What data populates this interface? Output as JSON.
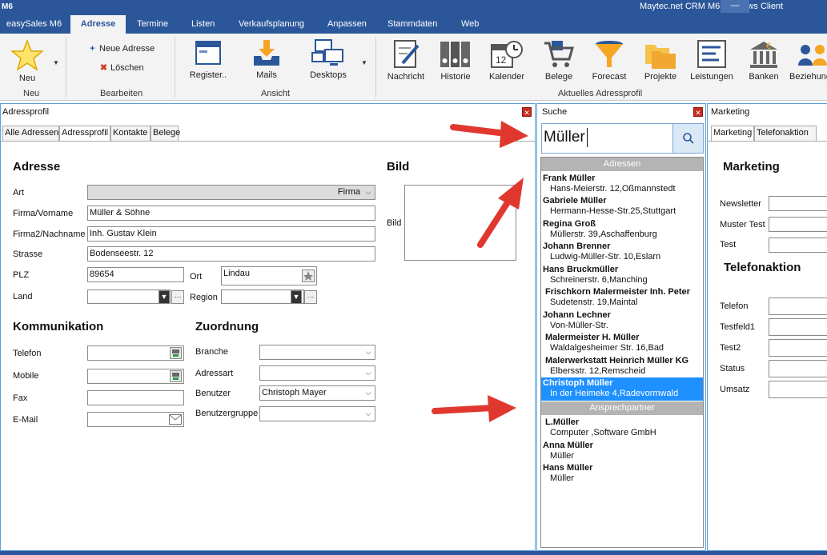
{
  "window": {
    "app_logo": "M6",
    "title": "Maytec.net CRM M6 Windows Client"
  },
  "menu_tabs": [
    {
      "label": "easySales M6"
    },
    {
      "label": "Adresse",
      "active": true
    },
    {
      "label": "Termine"
    },
    {
      "label": "Listen"
    },
    {
      "label": "Verkaufsplanung"
    },
    {
      "label": "Anpassen"
    },
    {
      "label": "Stammdaten"
    },
    {
      "label": "Web"
    }
  ],
  "ribbon": {
    "neu": {
      "button": "Neu",
      "group": "Neu"
    },
    "bearbeiten": {
      "neue_adresse": "Neue Adresse",
      "loeschen": "Löschen",
      "group": "Bearbeiten"
    },
    "ansicht": {
      "register": "Register..",
      "mails": "Mails",
      "desktops": "Desktops",
      "group": "Ansicht"
    },
    "profil": {
      "group": "Aktuelles Adressprofil",
      "buttons": [
        "Nachricht",
        "Historie",
        "Kalender",
        "Belege",
        "Forecast",
        "Projekte",
        "Leistungen",
        "Banken",
        "Beziehungen"
      ]
    }
  },
  "adressprofil": {
    "panel_title": "Adressprofil",
    "tabs": [
      "Alle Adressen",
      "Adressprofil",
      "Kontakte",
      "Belege"
    ],
    "adresse_title": "Adresse",
    "bild_title": "Bild",
    "bild_label": "Bild",
    "labels": {
      "art": "Art",
      "firma": "Firma/Vorname",
      "firma2": "Firma2/Nachname",
      "strasse": "Strasse",
      "plz": "PLZ",
      "ort": "Ort",
      "land": "Land",
      "region": "Region"
    },
    "values": {
      "art": "Firma",
      "firma": "Müller & Söhne",
      "firma2": "Inh. Gustav Klein",
      "strasse": "Bodenseestr. 12",
      "plz": "89654",
      "ort": "Lindau",
      "land": "",
      "region": ""
    },
    "kommunikation_title": "Kommunikation",
    "kommunikation_labels": {
      "telefon": "Telefon",
      "mobile": "Mobile",
      "fax": "Fax",
      "email": "E-Mail"
    },
    "zuordnung_title": "Zuordnung",
    "zuordnung_labels": {
      "branche": "Branche",
      "adressart": "Adressart",
      "benutzer": "Benutzer",
      "benutzergruppe": "Benutzergruppe"
    },
    "zuordnung_values": {
      "branche": "",
      "adressart": "",
      "benutzer": "Christoph Mayer",
      "benutzergruppe": ""
    },
    "more_button": "···"
  },
  "suche": {
    "panel_title": "Suche",
    "query": "Müller",
    "group_adressen": "Adressen",
    "adressen": [
      {
        "name": "Frank Müller",
        "detail": "Hans-Meierstr. 12,Oßmannstedt"
      },
      {
        "name": "Gabriele Müller",
        "detail": "Hermann-Hesse-Str.25,Stuttgart"
      },
      {
        "name": "Regina Groß",
        "detail": "Müllerstr. 39,Aschaffenburg"
      },
      {
        "name": "Johann Brenner",
        "detail": "Ludwig-Müller-Str. 10,Eslarn"
      },
      {
        "name": "Hans Bruckmüller",
        "detail": "Schreinerstr. 6,Manching"
      },
      {
        "name": "Frischkorn Malermeister Inh. Peter",
        "detail": "Sudetenstr. 19,Maintal"
      },
      {
        "name": "Johann Lechner",
        "detail": "Von-Müller-Str."
      },
      {
        "name": "Malermeister H. Müller",
        "detail": "Waldalgesheimer Str. 16,Bad"
      },
      {
        "name": "Malerwerkstatt Heinrich Müller KG",
        "detail": "Elbersstr. 12,Remscheid"
      },
      {
        "name": "Christoph Müller",
        "detail": "In der Heimeke 4,Radevormwald",
        "selected": true
      }
    ],
    "group_ansprechpartner": "Ansprechpartner",
    "ansprechpartner": [
      {
        "name": "L.Müller",
        "detail": "Computer ,Software GmbH"
      },
      {
        "name": "Anna Müller",
        "detail": "Müller"
      },
      {
        "name": "Hans Müller",
        "detail": "Müller"
      }
    ]
  },
  "marketing": {
    "panel_title": "Marketing",
    "tabs": [
      "Marketing",
      "Telefonaktion"
    ],
    "marketing_title": "Marketing",
    "marketing_labels": [
      "Newsletter",
      "Muster Test",
      "Test"
    ],
    "telefonaktion_title": "Telefonaktion",
    "telefonaktion_labels": [
      "Telefon",
      "Testfeld1",
      "Test2",
      "Status",
      "Umsatz"
    ]
  },
  "colors": {
    "accent": "#2b579a",
    "selection": "#1e90ff",
    "close": "#c42b1c",
    "arrow": "#e0382f"
  }
}
